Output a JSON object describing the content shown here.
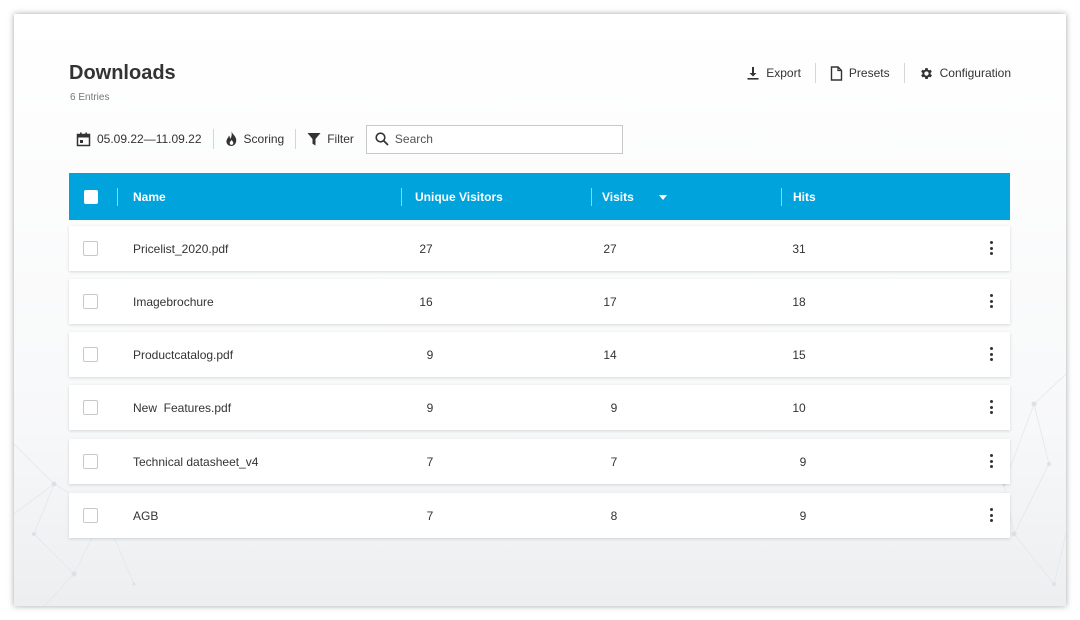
{
  "header": {
    "title": "Downloads",
    "entries": "6 Entries"
  },
  "actions": [
    {
      "label": "Export",
      "icon": "download-icon"
    },
    {
      "label": "Presets",
      "icon": "document-icon"
    },
    {
      "label": "Configuration",
      "icon": "gear-icon"
    }
  ],
  "toolbar": {
    "date_range": "05.09.22—11.09.22",
    "scoring_label": "Scoring",
    "filter_label": "Filter",
    "search_placeholder": "Search",
    "icons": {
      "date": "calendar-icon",
      "scoring": "flame-icon",
      "filter": "funnel-icon",
      "search": "search-icon"
    }
  },
  "table": {
    "header_color": "#00a3dc",
    "columns": [
      "Name",
      "Unique Visitors",
      "Visits",
      "Hits"
    ],
    "sorted_column": "Visits",
    "rows": [
      {
        "name": "Pricelist_2020.pdf",
        "unique_visitors": "27",
        "visits": "27",
        "hits": "31"
      },
      {
        "name": "Imagebrochure",
        "unique_visitors": "16",
        "visits": "17",
        "hits": "18"
      },
      {
        "name": "Productcatalog.pdf",
        "unique_visitors": "9",
        "visits": "14",
        "hits": "15"
      },
      {
        "name": "New  Features.pdf",
        "unique_visitors": "9",
        "visits": "9",
        "hits": "10"
      },
      {
        "name": "Technical datasheet_v4",
        "unique_visitors": "7",
        "visits": "7",
        "hits": "9"
      },
      {
        "name": "AGB",
        "unique_visitors": "7",
        "visits": "8",
        "hits": "9"
      }
    ]
  }
}
